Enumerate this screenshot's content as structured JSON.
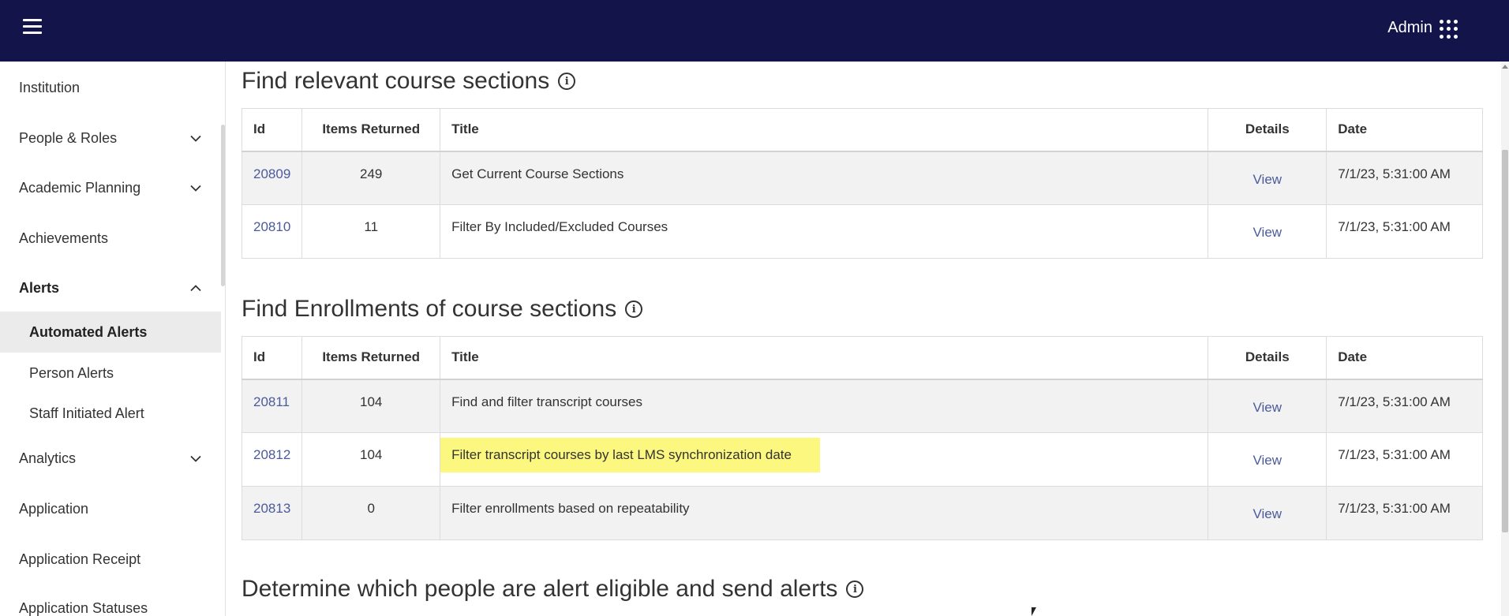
{
  "header": {
    "menu_icon": "hamburger-menu-icon",
    "user_label": "Admin",
    "apps_icon": "apps-grid-icon",
    "background": "#13154a"
  },
  "sidebar": {
    "items": [
      {
        "label": "Institution",
        "expandable": false
      },
      {
        "label": "People & Roles",
        "expandable": true
      },
      {
        "label": "Academic Planning",
        "expandable": true
      },
      {
        "label": "Achievements",
        "expandable": false
      },
      {
        "label": "Alerts",
        "expandable": true,
        "expanded": true
      },
      {
        "label": "Automated Alerts",
        "sub": true,
        "active": true
      },
      {
        "label": "Person Alerts",
        "sub": true
      },
      {
        "label": "Staff Initiated Alert",
        "sub": true
      },
      {
        "label": "Analytics",
        "expandable": true
      },
      {
        "label": "Application",
        "expandable": false
      },
      {
        "label": "Application Receipt",
        "expandable": false
      },
      {
        "label": "Application Statuses",
        "expandable": false
      }
    ]
  },
  "columns": {
    "id": "Id",
    "items_returned": "Items Returned",
    "title": "Title",
    "details": "Details",
    "date": "Date"
  },
  "sections": [
    {
      "title": "Find relevant course sections",
      "rows": [
        {
          "id": "20809",
          "items": "249",
          "title": "Get Current Course Sections",
          "details": "View",
          "date": "7/1/23, 5:31:00 AM"
        },
        {
          "id": "20810",
          "items": "11",
          "title": "Filter By Included/Excluded Courses",
          "details": "View",
          "date": "7/1/23, 5:31:00 AM"
        }
      ]
    },
    {
      "title": "Find Enrollments of course sections",
      "rows": [
        {
          "id": "20811",
          "items": "104",
          "title": "Find and filter transcript courses",
          "details": "View",
          "date": "7/1/23, 5:31:00 AM"
        },
        {
          "id": "20812",
          "items": "104",
          "title": "Filter transcript courses by last LMS synchronization date",
          "details": "View",
          "date": "7/1/23, 5:31:00 AM",
          "highlighted": true
        },
        {
          "id": "20813",
          "items": "0",
          "title": "Filter enrollments based on repeatability",
          "details": "View",
          "date": "7/1/23, 5:31:00 AM"
        }
      ]
    },
    {
      "title": "Determine which people are alert eligible and send alerts",
      "rows": []
    }
  ],
  "colors": {
    "link": "#4b5a9c",
    "highlight": "#fbf77f",
    "row_alt": "#f2f2f2"
  }
}
